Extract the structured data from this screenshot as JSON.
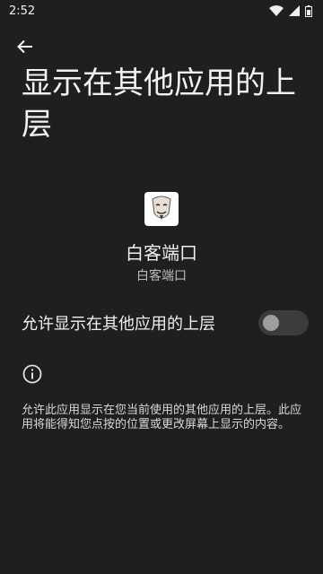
{
  "status_bar": {
    "time": "2:52",
    "icons": [
      "wifi-icon",
      "signal-icon",
      "battery-icon"
    ]
  },
  "header": {
    "back_icon": "arrow-back-icon",
    "title": "显示在其他应用的上层"
  },
  "app": {
    "icon": "mask-avatar-icon",
    "name": "白客端口",
    "subtitle": "白客端口"
  },
  "setting": {
    "label": "允许显示在其他应用的上层",
    "enabled": false
  },
  "info": {
    "icon": "info-icon",
    "description": "允许此应用显示在您当前使用的其他应用的上层。此应用将能得知您点按的位置或更改屏幕上显示的内容。"
  },
  "colors": {
    "background": "#1f1f1f",
    "text": "#f0f0f0",
    "switch_track": "#3c3c3c",
    "switch_thumb": "#9e9e9e"
  }
}
